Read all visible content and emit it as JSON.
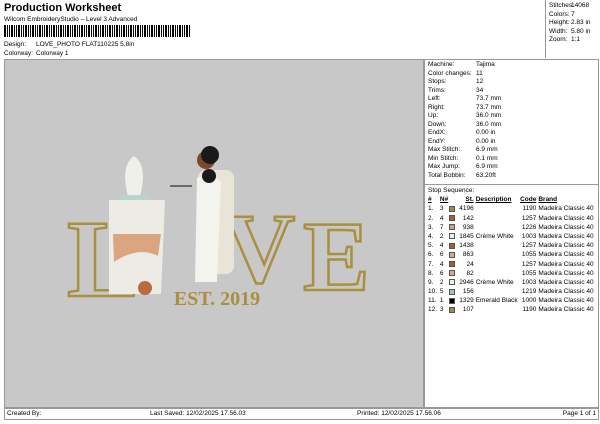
{
  "header": {
    "title": "Production Worksheet",
    "subtitle": "Wilcom EmbroideryStudio – Level 3 Advanced",
    "design_label": "Design:",
    "design_value": "LOVE_PHOTO FLAT110225 5,8in",
    "colorway_label": "Colorway:",
    "colorway_value": "Colorway 1"
  },
  "summary": [
    {
      "k": "Stitches:",
      "v": "14068"
    },
    {
      "k": "Colors:",
      "v": "7"
    },
    {
      "k": "Height:",
      "v": "2.83 in"
    },
    {
      "k": "Width:",
      "v": "5.80 in"
    },
    {
      "k": "Zoom:",
      "v": "1:1"
    }
  ],
  "info": [
    {
      "k": "Machine:",
      "v": "Tajima"
    },
    {
      "k": "Color changes:",
      "v": "11"
    },
    {
      "k": "Stops:",
      "v": "12"
    },
    {
      "k": "Trims:",
      "v": "34"
    },
    {
      "k": "Left:",
      "v": "73.7 mm"
    },
    {
      "k": "Right:",
      "v": "73.7 mm"
    },
    {
      "k": "Up:",
      "v": "36.0 mm"
    },
    {
      "k": "Down:",
      "v": "36.0 mm"
    },
    {
      "k": "EndX:",
      "v": "0.00 in"
    },
    {
      "k": "EndY:",
      "v": "0.00 in"
    },
    {
      "k": "Max Stitch:",
      "v": "6.9 mm"
    },
    {
      "k": "Min Stitch:",
      "v": "0.1 mm"
    },
    {
      "k": "Max Jump:",
      "v": "6.9 mm"
    },
    {
      "k": "Total Bobbin:",
      "v": "63.20ft"
    }
  ],
  "stops": {
    "title": "Stop Sequence:",
    "headers": [
      "#",
      "N#",
      "St.",
      "Description",
      "Code",
      "Brand"
    ],
    "rows": [
      {
        "n": "1.",
        "needle": "3",
        "color": "#9a8a4a",
        "st": "4196",
        "desc": "",
        "code": "1190",
        "brand": "Madeira Classic 40"
      },
      {
        "n": "2.",
        "needle": "4",
        "color": "#a85a36",
        "st": "142",
        "desc": "",
        "code": "1257",
        "brand": "Madeira Classic 40"
      },
      {
        "n": "3.",
        "needle": "7",
        "color": "#e09a72",
        "st": "938",
        "desc": "",
        "code": "1226",
        "brand": "Madeira Classic 40"
      },
      {
        "n": "4.",
        "needle": "2",
        "color": "#eeeee8",
        "st": "1845",
        "desc": "Crème White",
        "code": "1003",
        "brand": "Madeira Classic 40"
      },
      {
        "n": "5.",
        "needle": "4",
        "color": "#a85a36",
        "st": "1438",
        "desc": "",
        "code": "1257",
        "brand": "Madeira Classic 40"
      },
      {
        "n": "6.",
        "needle": "6",
        "color": "#d9a886",
        "st": "863",
        "desc": "",
        "code": "1055",
        "brand": "Madeira Classic 40"
      },
      {
        "n": "7.",
        "needle": "4",
        "color": "#a85a36",
        "st": "24",
        "desc": "",
        "code": "1257",
        "brand": "Madeira Classic 40"
      },
      {
        "n": "8.",
        "needle": "6",
        "color": "#d9a886",
        "st": "82",
        "desc": "",
        "code": "1055",
        "brand": "Madeira Classic 40"
      },
      {
        "n": "9.",
        "needle": "2",
        "color": "#eeeee8",
        "st": "2946",
        "desc": "Crème White",
        "code": "1003",
        "brand": "Madeira Classic 40"
      },
      {
        "n": "10.",
        "needle": "5",
        "color": "#9fc4c0",
        "st": "156",
        "desc": "",
        "code": "1219",
        "brand": "Madeira Classic 40"
      },
      {
        "n": "11.",
        "needle": "1",
        "color": "#000000",
        "st": "1329",
        "desc": "Emerald Black",
        "code": "1000",
        "brand": "Madeira Classic 40"
      },
      {
        "n": "12.",
        "needle": "3",
        "color": "#9a8a4a",
        "st": "107",
        "desc": "",
        "code": "1190",
        "brand": "Madeira Classic 40"
      }
    ]
  },
  "artwork": {
    "word_left": "L",
    "word_right1": "V",
    "word_right2": "E",
    "tagline": "EST. 2019"
  },
  "footer": {
    "created": "Created By:",
    "saved": "Last Saved: 12/02/2025 17.56.03",
    "printed": "Printed: 12/02/2025 17.56.06",
    "page": "Page 1 of 1"
  }
}
